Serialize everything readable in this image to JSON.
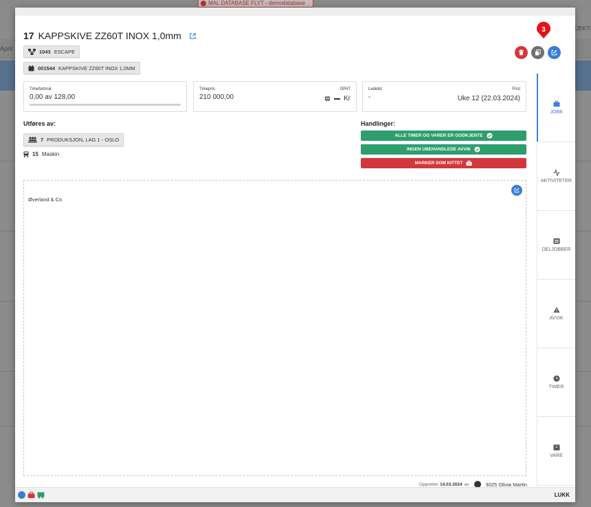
{
  "background": {
    "banner": "MAL DATABASE FLYT - demodatabase",
    "month": "April",
    "right_label": "PROSJEKTI"
  },
  "header": {
    "number": "17",
    "title": "KAPPSKIVE ZZ60T INOX 1,0mm",
    "chip_project_number": "1043",
    "chip_project_name": "ESCAPE",
    "chip_item_number": "001544",
    "chip_item_name": "KAPPSKIVE ZZ60T INOX 1,0MM"
  },
  "annotation_marker": "3",
  "cards": {
    "timeforbruk": {
      "label": "Timeforbruk",
      "value": "0,00 av 128,00",
      "progress": 0
    },
    "timepris": {
      "label": "Timepris",
      "value": "210 000,00",
      "right_label": "OPAT",
      "right_value": "Kr"
    },
    "ledetid": {
      "label": "Ledetid",
      "value": "-",
      "right_label": "Frist",
      "right_value": "Uke 12 (22.03.2024)"
    }
  },
  "utfores": {
    "title": "Utføres av:",
    "team_number": "7",
    "team_name": "PRODUKSJON, LAG 1 - OSLO",
    "machine_number": "15",
    "machine_name": "Maskin"
  },
  "handlinger": {
    "title": "Handlinger:",
    "buttons": [
      "ALLE TIMER OG VARER ER GODKJENTE",
      "INGEN UBEHANDLEDE AVVIK",
      "MARKER SOM KITTET"
    ]
  },
  "notes": {
    "text": "Øverland & Co"
  },
  "created": {
    "prefix": "Opprettet",
    "date": "14.03.2024",
    "by": "av",
    "user": "3025 Olivia Martin"
  },
  "tabs": [
    "JOBB",
    "AKTIVITETER",
    "DELJOBBER",
    "AVVIK",
    "TIMER",
    "VARE"
  ],
  "footer": {
    "close": "LUKK"
  },
  "colors": {
    "accent": "#3b7dd8",
    "danger": "#d2383b",
    "success": "#2e9e6e",
    "neutral": "#707070"
  }
}
